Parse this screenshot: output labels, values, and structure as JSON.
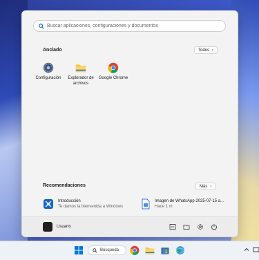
{
  "search": {
    "placeholder": "Buscar aplicaciones, configuraciones y documentos"
  },
  "pinned": {
    "title": "Anclado",
    "all_label": "Todos",
    "apps": [
      {
        "label": "Configuración",
        "icon": "settings-gear-icon"
      },
      {
        "label": "Explorador de archivos",
        "icon": "folder-icon"
      },
      {
        "label": "Google Chrome",
        "icon": "chrome-icon"
      }
    ]
  },
  "recommendations": {
    "title": "Recomendaciones",
    "more_label": "Más",
    "items": [
      {
        "title": "Introducción",
        "subtitle": "Te damos la bienvenida a Windows",
        "icon": "windows-intro-icon"
      },
      {
        "title": "Imagen de WhatsApp 2025-07-15 a...",
        "subtitle": "Hace 1 m",
        "icon": "document-icon"
      }
    ]
  },
  "footer": {
    "user_name": "Usuario"
  },
  "taskbar": {
    "search_label": "Búsqueda"
  },
  "colors": {
    "accent": "#0067c0",
    "panel": "#f3f3f3"
  }
}
